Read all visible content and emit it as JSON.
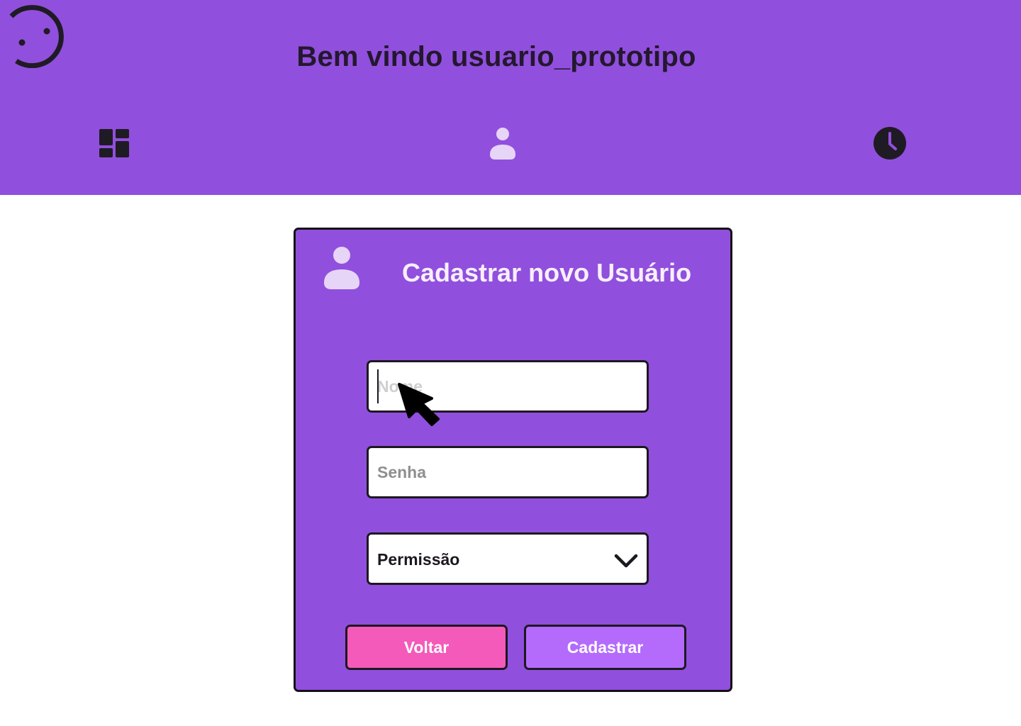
{
  "header": {
    "welcome_text": "Bem vindo usuario_prototipo",
    "logo_icon": "smiley-logo-icon",
    "nav": [
      {
        "name": "dashboard",
        "icon": "dashboard-icon",
        "active": false
      },
      {
        "name": "users",
        "icon": "user-icon",
        "active": true
      },
      {
        "name": "history",
        "icon": "clock-icon",
        "active": false
      }
    ]
  },
  "form": {
    "title": "Cadastrar novo Usuário",
    "icon": "user-icon",
    "name_field": {
      "value": "",
      "placeholder": "Nome"
    },
    "password_field": {
      "value": "",
      "placeholder": "Senha"
    },
    "permission_select": {
      "selected": "Permissão"
    },
    "back_label": "Voltar",
    "submit_label": "Cadastrar"
  },
  "colors": {
    "primary": "#914fdd",
    "text_dark": "#23182e",
    "back_button": "#f45ab9",
    "submit_button": "#b46bfc",
    "active_icon": "#e7d5f7"
  }
}
